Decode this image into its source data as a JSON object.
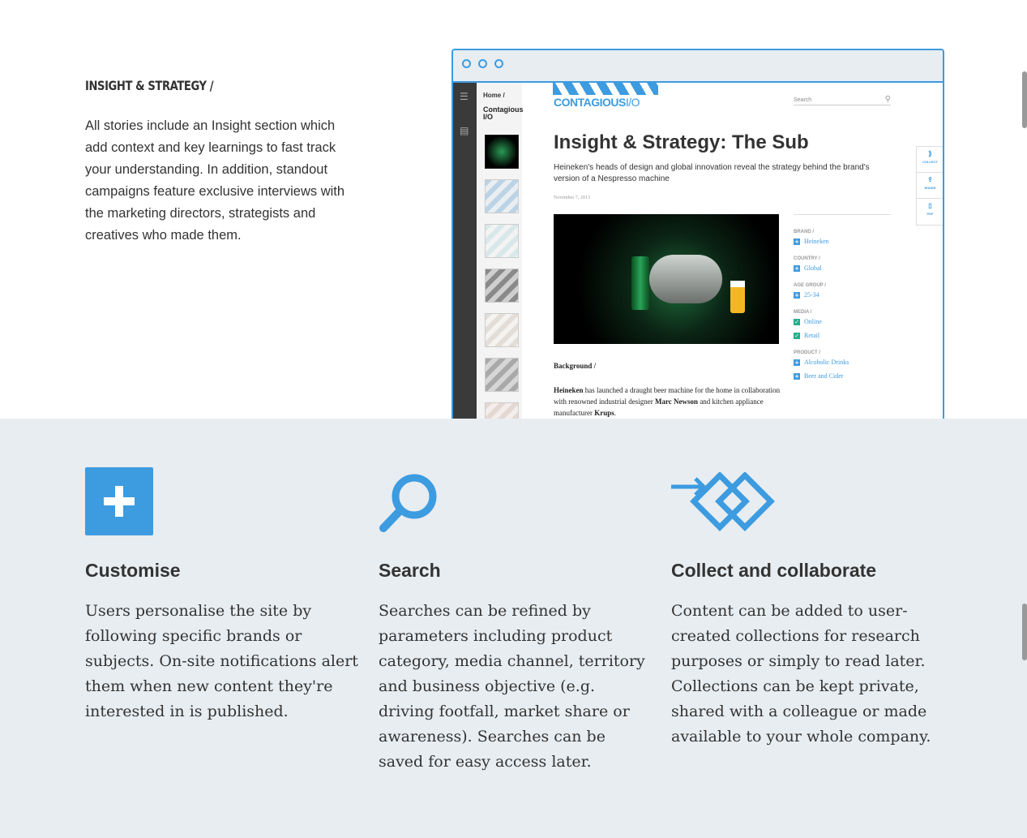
{
  "insight": {
    "heading": "INSIGHT & STRATEGY /",
    "text": "All stories include an Insight section which add context and key learnings to fast track your understanding. In addition, standout campaigns feature exclusive interviews with the marketing directors, strategists and creatives who made them."
  },
  "mockup": {
    "breadcrumb": "Home /",
    "section_title": "Contagious I/O",
    "logo_main": "CONTAGIOUS",
    "logo_suffix": "I/O",
    "search_placeholder": "Search",
    "article_title": "Insight & Strategy: The Sub",
    "article_subtitle": "Heineken's heads of design and global innovation reveal the strategy behind the brand's version of a Nespresso machine",
    "article_date": "November 7, 2013",
    "background_heading": "Background /",
    "body_parts": {
      "b1": "Heineken",
      "t1": " has launched a draught beer machine for the home in collaboration with renowned industrial designer ",
      "b2": "Marc Newson",
      "t2": " and kitchen appliance manufacturer ",
      "b3": "Krups",
      "t3": "."
    },
    "facets": [
      {
        "label": "BRAND /",
        "items": [
          {
            "text": "Heineken",
            "checked": false
          }
        ]
      },
      {
        "label": "COUNTRY /",
        "items": [
          {
            "text": "Global",
            "checked": false
          }
        ]
      },
      {
        "label": "AGE GROUP /",
        "items": [
          {
            "text": "25-34",
            "checked": false
          }
        ]
      },
      {
        "label": "MEDIA /",
        "items": [
          {
            "text": "Online",
            "checked": true
          },
          {
            "text": "Retail",
            "checked": true
          }
        ]
      },
      {
        "label": "PRODUCT /",
        "items": [
          {
            "text": "Alcoholic Drinks",
            "checked": false
          },
          {
            "text": "Beer and Cider",
            "checked": false
          }
        ]
      }
    ],
    "tools": [
      "COLLECT",
      "SHARE",
      "PDF"
    ]
  },
  "features": [
    {
      "title": "Customise",
      "icon": "plus-icon",
      "text": "Users personalise the site by following specific brands or subjects. On-site notifications alert them when new content they're interested in is published."
    },
    {
      "title": "Search",
      "icon": "magnifier-icon",
      "text": "Searches can be refined by parameters including product category, media channel, territory and business objective (e.g. driving footfall, market share or awareness). Searches can be saved for easy access later."
    },
    {
      "title": "Collect and collaborate",
      "icon": "collect-icon",
      "text": "Content can be added to user-created collections for research purposes or simply to read later. Collections can be kept private, shared with a colleague or made available to your whole company."
    }
  ],
  "colors": {
    "accent": "#3d9be0",
    "panel": "#e8edf1",
    "text": "#333333"
  }
}
